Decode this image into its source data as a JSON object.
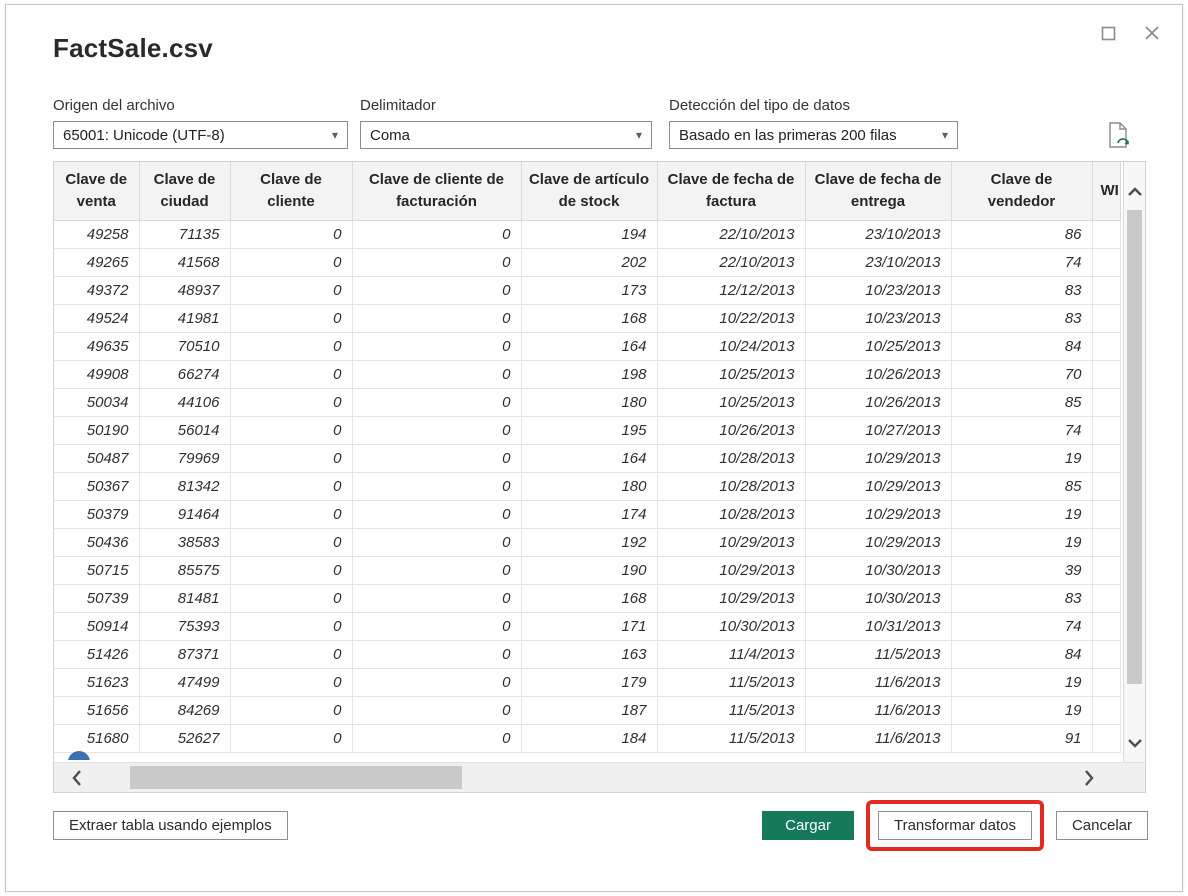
{
  "window": {
    "title": "FactSale.csv",
    "controls": {
      "maximize": "maximize",
      "close": "close"
    }
  },
  "settings": [
    {
      "label": "Origen del archivo",
      "value": "65001: Unicode (UTF-8)"
    },
    {
      "label": "Delimitador",
      "value": "Coma"
    },
    {
      "label": "Detección del tipo de datos",
      "value": "Basado en las primeras 200 filas"
    }
  ],
  "icons": {
    "refresh_preview": "document-refresh-icon",
    "dropdown_caret": "▾",
    "scroll_up": "chevron-up",
    "scroll_down": "chevron-down",
    "scroll_left": "chevron-left",
    "scroll_right": "chevron-right"
  },
  "table": {
    "columns": [
      "Clave de venta",
      "Clave de ciudad",
      "Clave de cliente",
      "Clave de cliente de facturación",
      "Clave de artículo de stock",
      "Clave de fecha de factura",
      "Clave de fecha de entrega",
      "Clave de vendedor",
      "WI"
    ],
    "rows": [
      [
        "49258",
        "71135",
        "0",
        "0",
        "194",
        "22/10/2013",
        "23/10/2013",
        "86",
        ""
      ],
      [
        "49265",
        "41568",
        "0",
        "0",
        "202",
        "22/10/2013",
        "23/10/2013",
        "74",
        ""
      ],
      [
        "49372",
        "48937",
        "0",
        "0",
        "173",
        "12/12/2013",
        "10/23/2013",
        "83",
        ""
      ],
      [
        "49524",
        "41981",
        "0",
        "0",
        "168",
        "10/22/2013",
        "10/23/2013",
        "83",
        ""
      ],
      [
        "49635",
        "70510",
        "0",
        "0",
        "164",
        "10/24/2013",
        "10/25/2013",
        "84",
        ""
      ],
      [
        "49908",
        "66274",
        "0",
        "0",
        "198",
        "10/25/2013",
        "10/26/2013",
        "70",
        ""
      ],
      [
        "50034",
        "44106",
        "0",
        "0",
        "180",
        "10/25/2013",
        "10/26/2013",
        "85",
        ""
      ],
      [
        "50190",
        "56014",
        "0",
        "0",
        "195",
        "10/26/2013",
        "10/27/2013",
        "74",
        ""
      ],
      [
        "50487",
        "79969",
        "0",
        "0",
        "164",
        "10/28/2013",
        "10/29/2013",
        "19",
        ""
      ],
      [
        "50367",
        "81342",
        "0",
        "0",
        "180",
        "10/28/2013",
        "10/29/2013",
        "85",
        ""
      ],
      [
        "50379",
        "91464",
        "0",
        "0",
        "174",
        "10/28/2013",
        "10/29/2013",
        "19",
        ""
      ],
      [
        "50436",
        "38583",
        "0",
        "0",
        "192",
        "10/29/2013",
        "10/29/2013",
        "19",
        ""
      ],
      [
        "50715",
        "85575",
        "0",
        "0",
        "190",
        "10/29/2013",
        "10/30/2013",
        "39",
        ""
      ],
      [
        "50739",
        "81481",
        "0",
        "0",
        "168",
        "10/29/2013",
        "10/30/2013",
        "83",
        ""
      ],
      [
        "50914",
        "75393",
        "0",
        "0",
        "171",
        "10/30/2013",
        "10/31/2013",
        "74",
        ""
      ],
      [
        "51426",
        "87371",
        "0",
        "0",
        "163",
        "11/4/2013",
        "11/5/2013",
        "84",
        ""
      ],
      [
        "51623",
        "47499",
        "0",
        "0",
        "179",
        "11/5/2013",
        "11/6/2013",
        "19",
        ""
      ],
      [
        "51656",
        "84269",
        "0",
        "0",
        "187",
        "11/5/2013",
        "11/6/2013",
        "19",
        ""
      ],
      [
        "51680",
        "52627",
        "0",
        "0",
        "184",
        "11/5/2013",
        "11/6/2013",
        "91",
        ""
      ]
    ]
  },
  "footer": {
    "extract_button": "Extraer tabla usando ejemplos",
    "load_button": "Cargar",
    "transform_button": "Transformar datos",
    "cancel_button": "Cancelar"
  },
  "colors": {
    "load_button": "#15795c",
    "annotation_highlight": "#e02b20",
    "header_background": "#f3f3f3",
    "refresh_icon_accent": "#217346"
  }
}
